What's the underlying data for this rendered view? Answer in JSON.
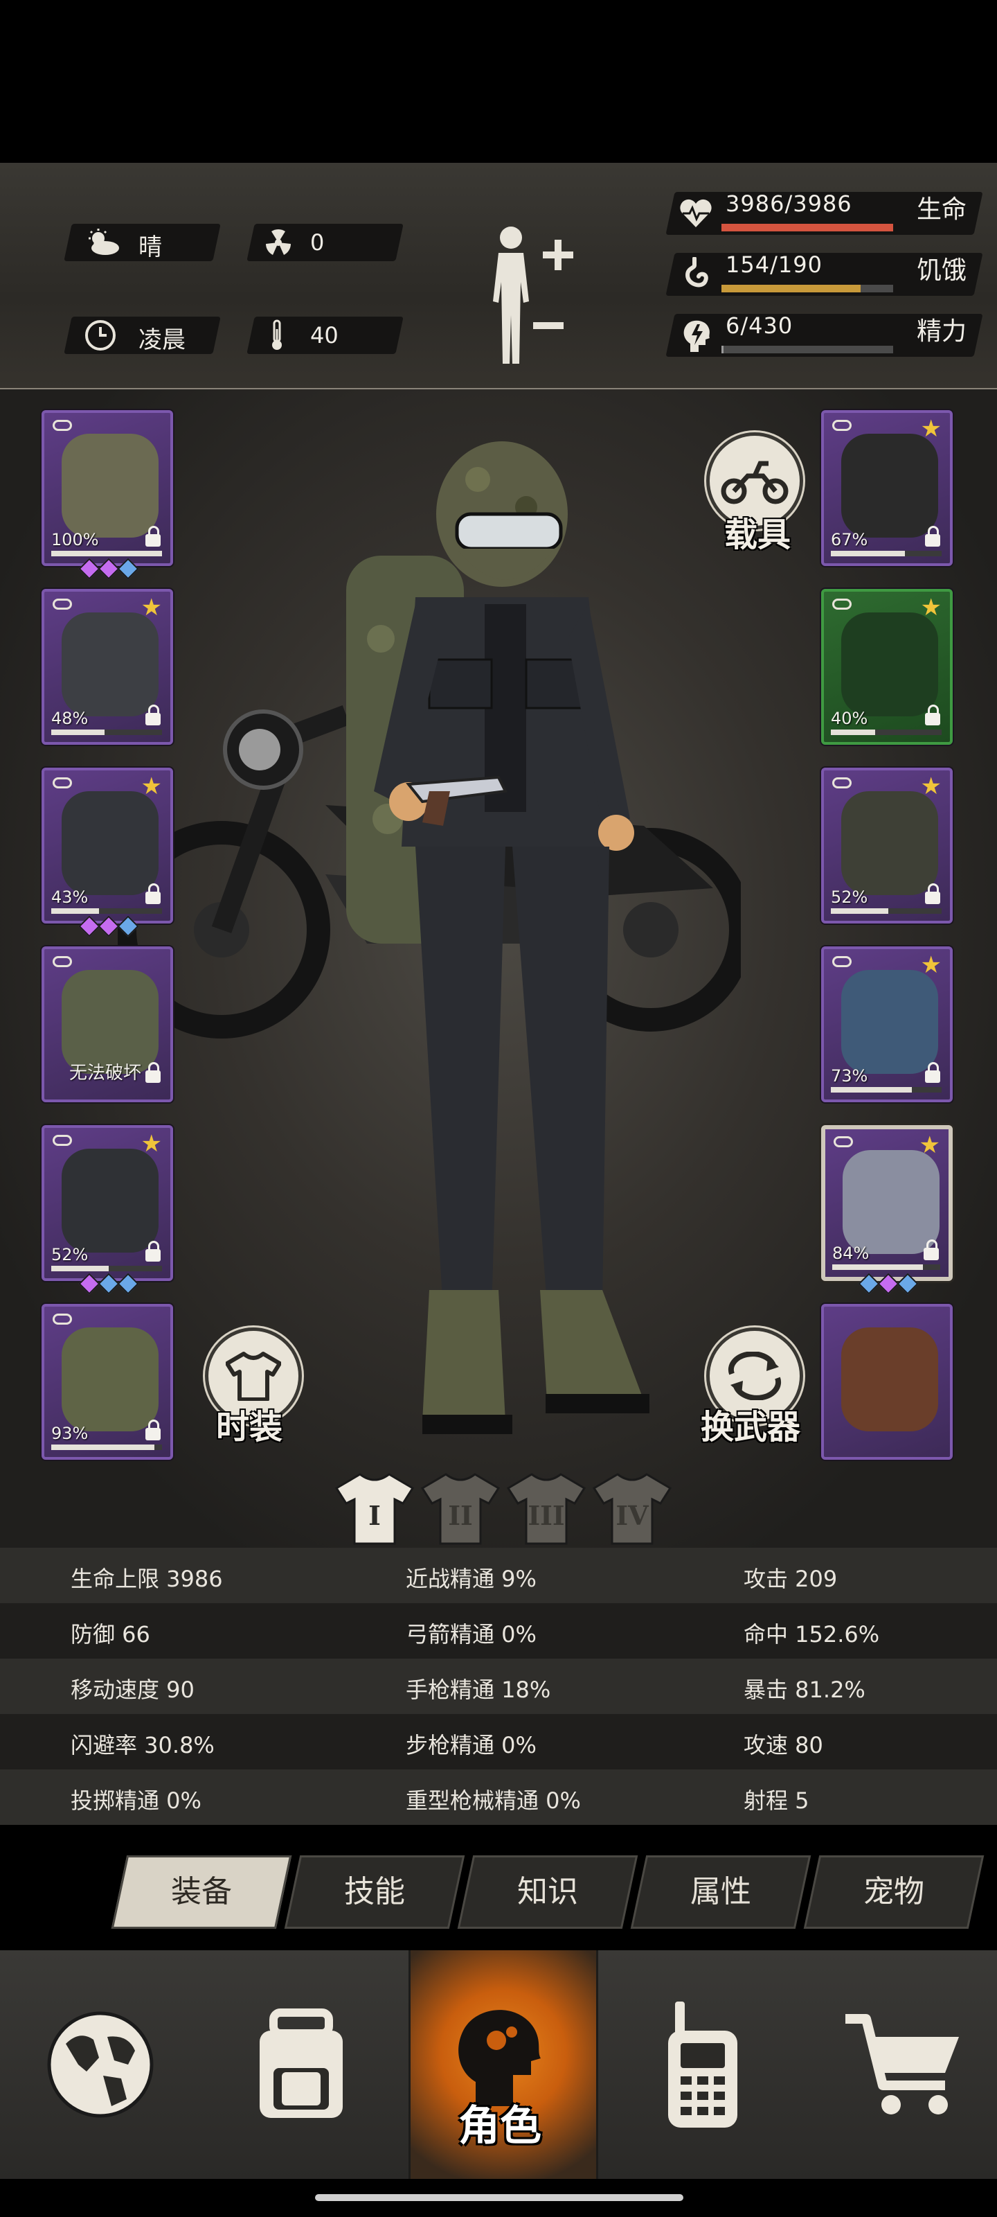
{
  "status": {
    "weather": "晴",
    "radiation": "0",
    "time_of_day": "凌晨",
    "temperature": "40",
    "icons": [
      "cloud-sun-icon",
      "radiation-icon",
      "clock-icon",
      "thermometer-icon",
      "body-icon"
    ]
  },
  "vitals": [
    {
      "value": "3986/3986",
      "label": "生命",
      "fraction": 1.0,
      "color": "#d4543f",
      "icon": "heart-icon"
    },
    {
      "value": "154/190",
      "label": "饥饿",
      "fraction": 0.81,
      "color": "#c89a3a",
      "icon": "stomach-icon"
    },
    {
      "value": "6/430",
      "label": "精力",
      "fraction": 0.014,
      "color": "#9a9a9a",
      "icon": "energy-head-icon"
    }
  ],
  "left_slots": [
    {
      "name": "slot-helmet",
      "pct": "100%",
      "star": false,
      "durability": 1.0,
      "gems": [
        "#c56cf0",
        "#c56cf0",
        "#6aa8e8"
      ],
      "art": "#6b6a52"
    },
    {
      "name": "slot-shirt",
      "pct": "48%",
      "star": true,
      "durability": 0.48,
      "gems": [],
      "art": "#3d3f44"
    },
    {
      "name": "slot-jacket",
      "pct": "43%",
      "star": true,
      "durability": 0.43,
      "gems": [
        "#c56cf0",
        "#c56cf0",
        "#6aa8e8"
      ],
      "art": "#33353a"
    },
    {
      "name": "slot-backpack",
      "pct": "",
      "unbreakable": "无法破坏",
      "star": false,
      "durability": 0,
      "gems": [],
      "art": "#5a6048"
    },
    {
      "name": "slot-pants",
      "pct": "52%",
      "star": true,
      "durability": 0.52,
      "gems": [
        "#c56cf0",
        "#6aa8e8",
        "#6aa8e8"
      ],
      "art": "#2f3135"
    },
    {
      "name": "slot-boots",
      "pct": "93%",
      "star": false,
      "durability": 0.93,
      "gems": [],
      "art": "#5f6446"
    }
  ],
  "right_slots": [
    {
      "name": "slot-goggles",
      "pct": "67%",
      "star": true,
      "durability": 0.67,
      "green": false,
      "gems": [],
      "art": "#2a2a2a"
    },
    {
      "name": "slot-mask",
      "pct": "40%",
      "star": true,
      "durability": 0.4,
      "green": true,
      "gems": [],
      "art": "#1e3e20"
    },
    {
      "name": "slot-vest",
      "pct": "52%",
      "star": true,
      "durability": 0.52,
      "green": false,
      "gems": [],
      "art": "#3e4036"
    },
    {
      "name": "slot-gloves",
      "pct": "73%",
      "star": true,
      "durability": 0.73,
      "green": false,
      "gems": [],
      "art": "#3f5a78"
    },
    {
      "name": "slot-revolver",
      "pct": "84%",
      "star": true,
      "durability": 0.84,
      "green": false,
      "selected": true,
      "gems": [
        "#6aa8e8",
        "#c56cf0",
        "#6aa8e8"
      ],
      "art": "#8a8ea0"
    },
    {
      "name": "slot-dynamite",
      "pct": "",
      "star": false,
      "durability": 0,
      "green": false,
      "nolink": true,
      "gems": [],
      "art": "#6a3e2a"
    }
  ],
  "buttons": {
    "vehicle": "载具",
    "fashion": "时装",
    "switch_weapon": "换武器"
  },
  "outfits": [
    "I",
    "II",
    "III",
    "IV"
  ],
  "stats": [
    [
      "生命上限 3986",
      "近战精通 9%",
      "攻击 209"
    ],
    [
      "防御 66",
      "弓箭精通 0%",
      "命中 152.6%"
    ],
    [
      "移动速度 90",
      "手枪精通 18%",
      "暴击 81.2%"
    ],
    [
      "闪避率 30.8%",
      "步枪精通 0%",
      "攻速 80"
    ],
    [
      "投掷精通 0%",
      "重型枪械精通 0%",
      "射程 5"
    ]
  ],
  "tabs": [
    "装备",
    "技能",
    "知识",
    "属性",
    "宠物"
  ],
  "nav": {
    "items": [
      "globe-icon",
      "backpack-icon",
      "character-icon",
      "radio-icon",
      "cart-icon"
    ],
    "active_label": "角色"
  }
}
